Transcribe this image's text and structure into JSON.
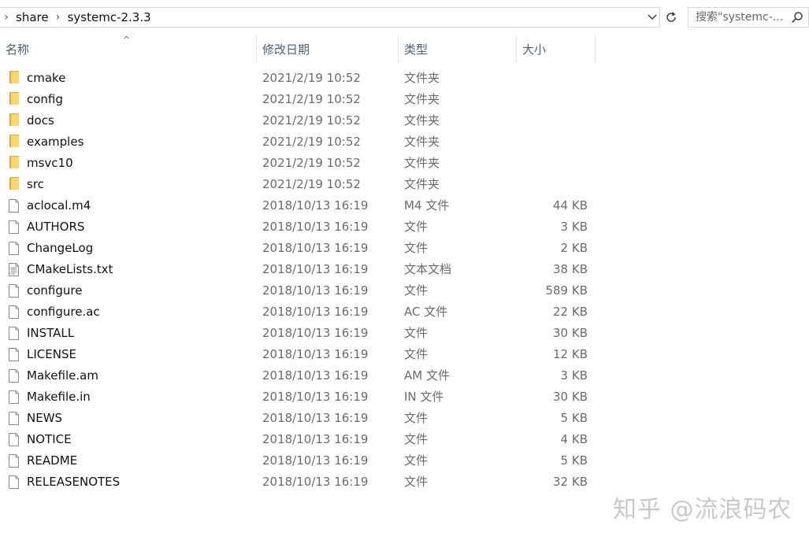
{
  "address_bar": {
    "breadcrumbs": [
      "share",
      "systemc-2.3.3"
    ],
    "dropdown_icon": "chevron-down-icon",
    "refresh_icon": "refresh-icon"
  },
  "search": {
    "placeholder": "搜索\"systemc-...",
    "icon": "search-icon"
  },
  "columns": {
    "name": "名称",
    "date": "修改日期",
    "type": "类型",
    "size": "大小",
    "sort_indicator": "^"
  },
  "files": [
    {
      "name": "cmake",
      "date": "2021/2/19 10:52",
      "type": "文件夹",
      "size": "",
      "icon": "folder-icon"
    },
    {
      "name": "config",
      "date": "2021/2/19 10:52",
      "type": "文件夹",
      "size": "",
      "icon": "folder-icon"
    },
    {
      "name": "docs",
      "date": "2021/2/19 10:52",
      "type": "文件夹",
      "size": "",
      "icon": "folder-icon"
    },
    {
      "name": "examples",
      "date": "2021/2/19 10:52",
      "type": "文件夹",
      "size": "",
      "icon": "folder-icon"
    },
    {
      "name": "msvc10",
      "date": "2021/2/19 10:52",
      "type": "文件夹",
      "size": "",
      "icon": "folder-icon"
    },
    {
      "name": "src",
      "date": "2021/2/19 10:52",
      "type": "文件夹",
      "size": "",
      "icon": "folder-icon"
    },
    {
      "name": "aclocal.m4",
      "date": "2018/10/13 16:19",
      "type": "M4 文件",
      "size": "44 KB",
      "icon": "file-icon"
    },
    {
      "name": "AUTHORS",
      "date": "2018/10/13 16:19",
      "type": "文件",
      "size": "3 KB",
      "icon": "file-icon"
    },
    {
      "name": "ChangeLog",
      "date": "2018/10/13 16:19",
      "type": "文件",
      "size": "2 KB",
      "icon": "file-icon"
    },
    {
      "name": "CMakeLists.txt",
      "date": "2018/10/13 16:19",
      "type": "文本文档",
      "size": "38 KB",
      "icon": "text-file-icon"
    },
    {
      "name": "configure",
      "date": "2018/10/13 16:19",
      "type": "文件",
      "size": "589 KB",
      "icon": "file-icon"
    },
    {
      "name": "configure.ac",
      "date": "2018/10/13 16:19",
      "type": "AC 文件",
      "size": "22 KB",
      "icon": "file-icon"
    },
    {
      "name": "INSTALL",
      "date": "2018/10/13 16:19",
      "type": "文件",
      "size": "30 KB",
      "icon": "file-icon"
    },
    {
      "name": "LICENSE",
      "date": "2018/10/13 16:19",
      "type": "文件",
      "size": "12 KB",
      "icon": "file-icon"
    },
    {
      "name": "Makefile.am",
      "date": "2018/10/13 16:19",
      "type": "AM 文件",
      "size": "3 KB",
      "icon": "file-icon"
    },
    {
      "name": "Makefile.in",
      "date": "2018/10/13 16:19",
      "type": "IN 文件",
      "size": "30 KB",
      "icon": "file-icon"
    },
    {
      "name": "NEWS",
      "date": "2018/10/13 16:19",
      "type": "文件",
      "size": "5 KB",
      "icon": "file-icon"
    },
    {
      "name": "NOTICE",
      "date": "2018/10/13 16:19",
      "type": "文件",
      "size": "4 KB",
      "icon": "file-icon"
    },
    {
      "name": "README",
      "date": "2018/10/13 16:19",
      "type": "文件",
      "size": "5 KB",
      "icon": "file-icon"
    },
    {
      "name": "RELEASENOTES",
      "date": "2018/10/13 16:19",
      "type": "文件",
      "size": "32 KB",
      "icon": "file-icon"
    }
  ],
  "watermark": "知乎 @流浪码农",
  "colors": {
    "header_text": "#4c607a",
    "folder_back": "#e4a82c",
    "folder_front": "#f8d775",
    "secondary_text": "#6b6b6b"
  }
}
